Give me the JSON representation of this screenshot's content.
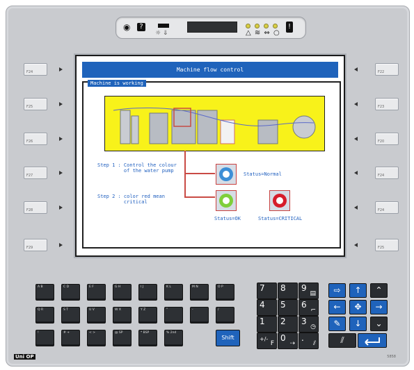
{
  "status_panel": {
    "help_label": "?",
    "exclamation_label": "!",
    "symbols_label": "△ ≋ ⇔ ○",
    "sun_symbol": "☼ ⇓"
  },
  "function_keys": {
    "left": [
      "F24",
      "F25",
      "F26",
      "F27",
      "F28",
      "F29"
    ],
    "right": [
      "F22",
      "F23",
      "F20",
      "F24",
      "F24",
      "F25"
    ]
  },
  "screen": {
    "title": "Machine flow control",
    "group_title": "Machine is working",
    "step1": "Step 1 : Control the colour\n         of the water pump",
    "step1_status": "Status=Normal",
    "step2": "Step 2 : color red mean\n         critical",
    "status_ok": "Status=OK",
    "status_critical": "Status=CRITICAL"
  },
  "keyboard": {
    "letters": [
      [
        "A   B",
        "C   D",
        "E   F",
        "G   H",
        "I   J",
        "K   L",
        "M   N",
        "O   P"
      ],
      [
        "Q   R",
        "S   T",
        "U   V",
        "W   X",
        "Y   Z",
        "\"",
        "-",
        "/"
      ],
      [
        "!",
        "# +",
        "< >",
        "@   SP",
        "*   BSP",
        "%   2nd"
      ]
    ],
    "numbers": [
      [
        "7",
        "8",
        "9"
      ],
      [
        "4",
        "5",
        "6"
      ],
      [
        "1",
        "2",
        "3"
      ],
      [
        "+/-",
        "0",
        "."
      ]
    ],
    "shift_label": "Shift"
  },
  "colors": {
    "accent_blue": "#1f63bb",
    "diagram_yellow": "#f8f21a",
    "critical_red": "#d61d2b",
    "ok_green": "#7fcf3b",
    "normal_blue": "#3d8ed6"
  },
  "brand": {
    "logo_text": "Uni OP",
    "model_text": "5858"
  }
}
